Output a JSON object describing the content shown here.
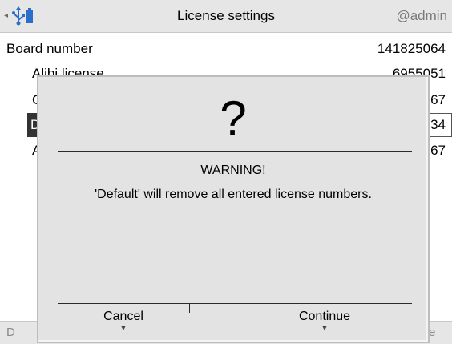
{
  "header": {
    "title": "License settings",
    "user": "@admin",
    "nav_icon": "◂",
    "icons": [
      "back-arrow-icon",
      "usb-icon",
      "battery-icon"
    ]
  },
  "list": {
    "board_number": {
      "label": "Board number",
      "value": "141825064"
    },
    "rows": [
      {
        "label": "Alibi license",
        "value": "6955051"
      },
      {
        "label": "C",
        "value": "67"
      },
      {
        "label": "D",
        "value": "34"
      },
      {
        "label": "A",
        "value": "67"
      }
    ]
  },
  "footer": {
    "left": "D",
    "right": "e"
  },
  "dialog": {
    "symbol": "?",
    "title": "WARNING!",
    "message": "'Default' will remove all entered license numbers.",
    "buttons": {
      "cancel": "Cancel",
      "continue": "Continue"
    },
    "arrow": "▼"
  },
  "colors": {
    "header_bg": "#e6e6e6",
    "dialog_bg": "#e3e3e3",
    "usb_icon": "#2a6ec9",
    "selection": "#333333"
  }
}
